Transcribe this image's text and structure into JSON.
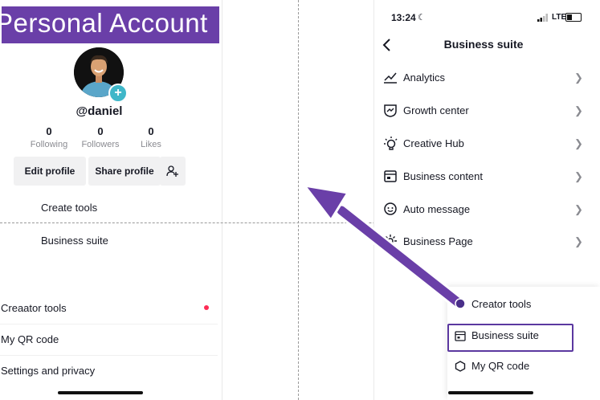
{
  "banner": {
    "text": "Personal Account"
  },
  "profile": {
    "username": "@daniel",
    "stats": [
      {
        "value": "0",
        "label": "Following"
      },
      {
        "value": "0",
        "label": "Followers"
      },
      {
        "value": "0",
        "label": "Likes"
      }
    ],
    "buttons": {
      "edit": "Edit profile",
      "share": "Share profile"
    }
  },
  "left_menu": {
    "create_tools": "Create tools",
    "business_suite": "Business suite",
    "items": [
      "Creaator tools",
      "My QR code",
      "Settings and privacy"
    ]
  },
  "status_bar": {
    "time": "13:24",
    "network": "LTE"
  },
  "business_suite": {
    "title": "Business suite",
    "items": [
      {
        "label": "Analytics",
        "icon": "analytics-icon"
      },
      {
        "label": "Growth center",
        "icon": "growth-center-icon"
      },
      {
        "label": "Creative Hub",
        "icon": "creative-hub-icon"
      },
      {
        "label": "Business content",
        "icon": "business-content-icon"
      },
      {
        "label": "Auto message",
        "icon": "auto-message-icon"
      },
      {
        "label": "Business Page",
        "icon": "business-page-icon"
      }
    ]
  },
  "sheet": {
    "items": [
      "Creator tools",
      "Business suite",
      "My QR code"
    ]
  },
  "colors": {
    "banner": "#6a3fa8",
    "arrow": "#6a3fa8",
    "highlight": "#5b38a0",
    "avatar_badge": "#3fb7c9",
    "dot": "#fe2c55"
  }
}
